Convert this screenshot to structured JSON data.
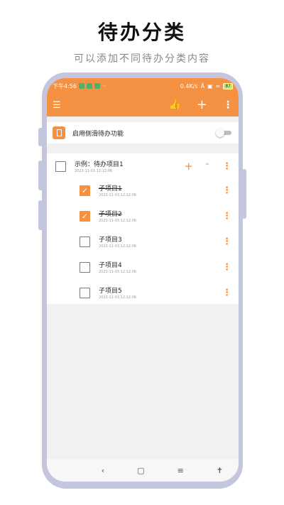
{
  "promo": {
    "title": "待办分类",
    "subtitle": "可以添加不同待办分类内容"
  },
  "status_bar": {
    "time": "下午4:56",
    "notif_more": "··",
    "speed": "0.4K/s",
    "battery": "87"
  },
  "toolbar": {
    "menu_icon": "list-icon",
    "like_icon": "thumbs-up-icon",
    "add_icon": "plus-icon",
    "more_icon": "more-vert-icon"
  },
  "feature": {
    "label": "启用侧滑待办功能",
    "enabled": false
  },
  "todo": {
    "title": "示例：待办项目1",
    "date": "2023-11-03 12:12:06",
    "checked": false,
    "subitems": [
      {
        "title": "子项目1",
        "date": "2023-11-03 12:12:06",
        "checked": true
      },
      {
        "title": "子项目2",
        "date": "2023-11-03 12:12:06",
        "checked": true
      },
      {
        "title": "子项目3",
        "date": "2023-11-03 12:12:06",
        "checked": false
      },
      {
        "title": "子项目4",
        "date": "2023-11-03 12:12:06",
        "checked": false
      },
      {
        "title": "子项目5",
        "date": "2023-11-03 12:12:06",
        "checked": false
      }
    ]
  },
  "colors": {
    "accent": "#f59143",
    "frame": "#c3c6dc"
  }
}
